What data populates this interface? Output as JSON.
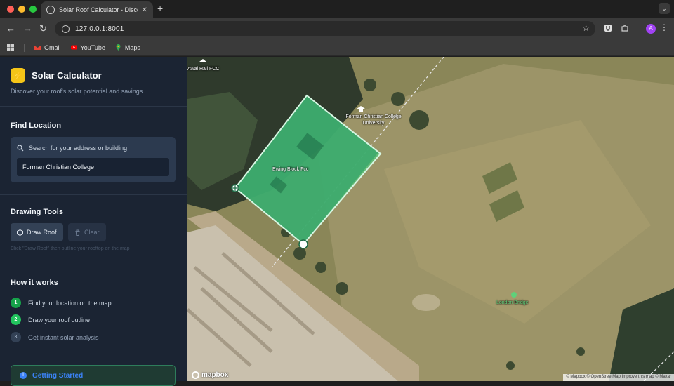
{
  "browser": {
    "tab_title": "Solar Roof Calculator - Disco",
    "tab_close": "✕",
    "new_tab": "+",
    "url": "127.0.0.1:8001",
    "profile_initial": "A",
    "traffic_lights": [
      "#ff5f57",
      "#febc2e",
      "#28c840"
    ],
    "bookmarks": [
      {
        "label": "Gmail",
        "icon": "gmail-icon"
      },
      {
        "label": "YouTube",
        "icon": "youtube-icon"
      },
      {
        "label": "Maps",
        "icon": "maps-icon"
      }
    ]
  },
  "sidebar": {
    "title": "Solar Calculator",
    "subtitle": "Discover your roof's solar potential and savings",
    "find_location": {
      "heading": "Find Location",
      "search_label": "Search for your address or building",
      "search_value": "Forman Christian College"
    },
    "drawing_tools": {
      "heading": "Drawing Tools",
      "draw_label": "Draw Roof",
      "clear_label": "Clear",
      "hint": "Click \"Draw Roof\" then outline your rooftop on the map"
    },
    "how_it_works": {
      "heading": "How it works",
      "steps": [
        {
          "num": "1",
          "label": "Find your location on the map",
          "state": "done"
        },
        {
          "num": "2",
          "label": "Draw your roof outline",
          "state": "active"
        },
        {
          "num": "3",
          "label": "Get instant solar analysis",
          "state": "pending"
        }
      ]
    },
    "getting_started": "Getting Started",
    "colors": {
      "accent": "#22c55e",
      "bolt": "#f5c518",
      "panel": "#1b2433"
    }
  },
  "map": {
    "labels": {
      "hall": " Awal Hall FCC",
      "university": "Forman Christian College University",
      "block": "Ewing Block Fcc",
      "bridge": "London Bridge"
    },
    "logo": "mapbox",
    "attribution": "© Mapbox © OpenStreetMap Improve this map © Maxar",
    "polygon_fill": "#3ddc84"
  }
}
